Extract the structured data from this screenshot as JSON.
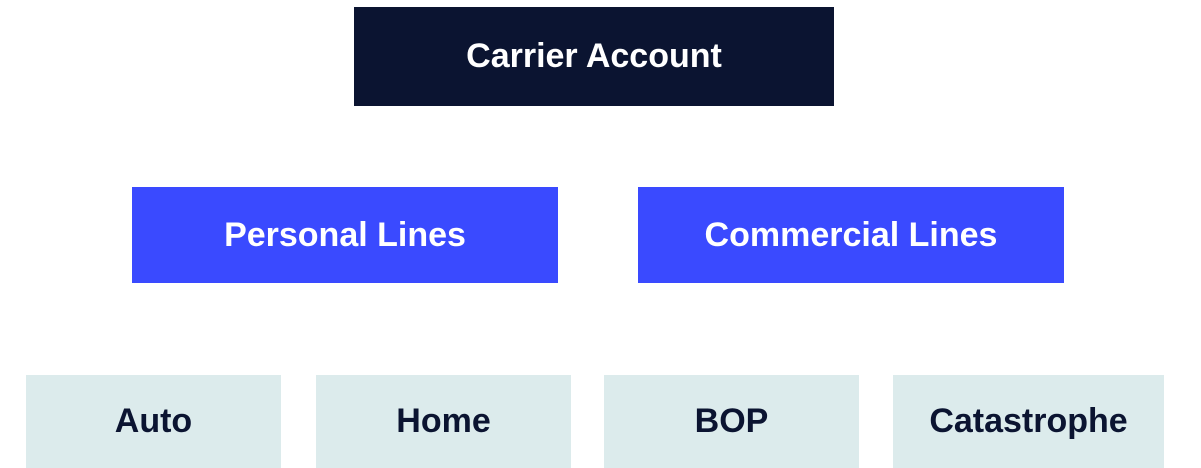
{
  "colors": {
    "root_bg": "#0B1431",
    "root_text": "#FFFFFF",
    "mid_bg": "#3A4AFF",
    "mid_text": "#FFFFFF",
    "leaf_bg": "#DCEBEC",
    "leaf_text": "#0B1431"
  },
  "root": {
    "label": "Carrier Account"
  },
  "branches": [
    {
      "label": "Personal Lines"
    },
    {
      "label": "Commercial Lines"
    }
  ],
  "leaves": [
    {
      "label": "Auto"
    },
    {
      "label": "Home"
    },
    {
      "label": "BOP"
    },
    {
      "label": "Catastrophe"
    }
  ]
}
